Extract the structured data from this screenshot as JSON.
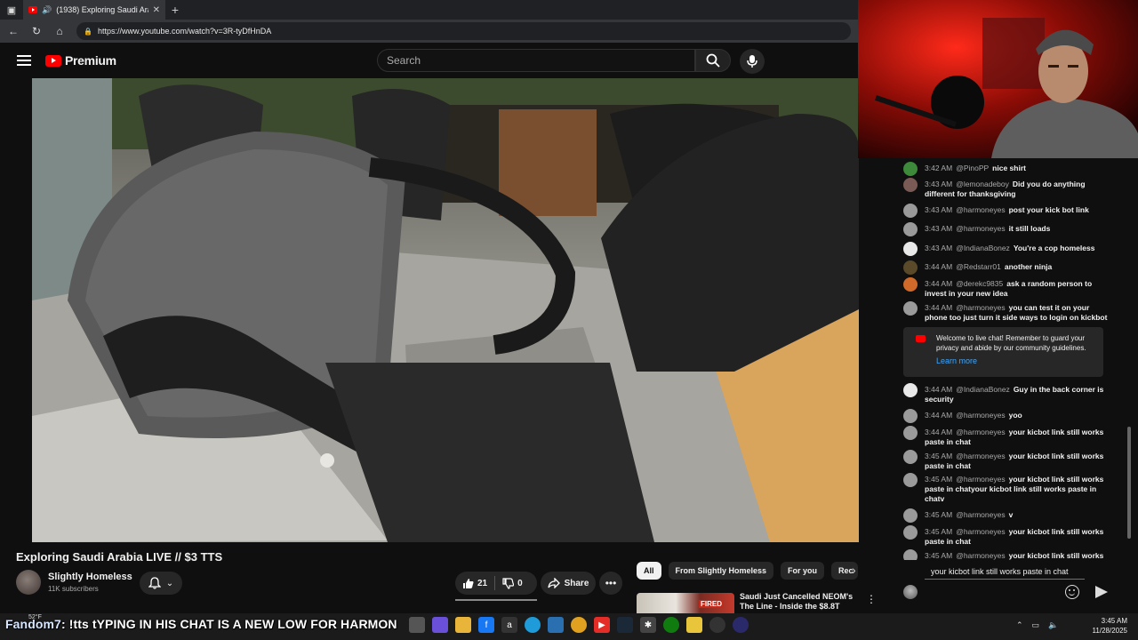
{
  "browser": {
    "tab_title": "(1938) Exploring Saudi Arabi",
    "url": "https://www.youtube.com/watch?v=3R-tyDfHnDA"
  },
  "masthead": {
    "logo_text": "Premium",
    "search_placeholder": "Search"
  },
  "video": {
    "title": "Exploring Saudi Arabia LIVE // $3 TTS",
    "channel_name": "Slightly Homeless",
    "subscribers": "11K subscribers",
    "likes": "21",
    "dislikes": "0",
    "share_label": "Share"
  },
  "chips": [
    "All",
    "From Slightly Homeless",
    "For you",
    "Rec"
  ],
  "recommended": {
    "title": "Saudi Just Cancelled NEOM's The Line - Inside the $8.8T",
    "thumb_badge": "FIRED"
  },
  "chat": {
    "messages": [
      {
        "time": "3:42 AM",
        "author": "@PinoPP",
        "text": "nice shirt",
        "avatar_color": "#3c8a3a"
      },
      {
        "time": "3:43 AM",
        "author": "@lemonadeboy",
        "text": "Did you do anything different for thanksgiving",
        "avatar_color": "#7a5a55"
      },
      {
        "time": "3:43 AM",
        "author": "@harmoneyes",
        "text": "post your kick bot link",
        "avatar_color": "#9a9a9a"
      },
      {
        "time": "3:43 AM",
        "author": "@harmoneyes",
        "text": "it still loads",
        "avatar_color": "#9a9a9a"
      },
      {
        "time": "3:43 AM",
        "author": "@IndianaBonez",
        "text": "You're a cop homeless",
        "avatar_color": "#e8e8e8"
      },
      {
        "time": "3:44 AM",
        "author": "@Redstarr01",
        "text": "another ninja",
        "avatar_color": "#5a4a2a"
      },
      {
        "time": "3:44 AM",
        "author": "@derekc9835",
        "text": "ask a random person to invest in your new idea",
        "avatar_color": "#d06a2a"
      },
      {
        "time": "3:44 AM",
        "author": "@harmoneyes",
        "text": "you can test it on your phone too just turn it side ways to login on kickbot",
        "avatar_color": "#9a9a9a"
      },
      {
        "time": "3:44 AM",
        "author": "@IndianaBonez",
        "text": "Guy in the back corner is security",
        "avatar_color": "#e8e8e8"
      },
      {
        "time": "3:44 AM",
        "author": "@harmoneyes",
        "text": "yoo",
        "avatar_color": "#9a9a9a"
      },
      {
        "time": "3:44 AM",
        "author": "@harmoneyes",
        "text": "your kicbot link still works paste in chat",
        "avatar_color": "#9a9a9a"
      },
      {
        "time": "3:45 AM",
        "author": "@harmoneyes",
        "text": "your kicbot link still works paste in chat",
        "avatar_color": "#9a9a9a"
      },
      {
        "time": "3:45 AM",
        "author": "@harmoneyes",
        "text": "your kicbot link still works paste in chatyour kicbot link still works paste in chatv",
        "avatar_color": "#9a9a9a"
      },
      {
        "time": "3:45 AM",
        "author": "@harmoneyes",
        "text": "v",
        "avatar_color": "#9a9a9a"
      },
      {
        "time": "3:45 AM",
        "author": "@harmoneyes",
        "text": "your kicbot link still works paste in chat",
        "avatar_color": "#9a9a9a"
      },
      {
        "time": "3:45 AM",
        "author": "@harmoneyes",
        "text": "your kicbot link still works",
        "avatar_color": "#9a9a9a"
      }
    ],
    "welcome_text": "Welcome to live chat! Remember to guard your privacy and abide by our community guidelines.",
    "learn_more": "Learn more",
    "input_value": "your kicbot link still works paste in chat"
  },
  "overlay": {
    "caption_name": "Fandom7",
    "caption_text": ": !tts tYPING IN HIS CHAT IS A NEW LOW FOR HARMON",
    "weather": "52°F"
  },
  "taskbar": {
    "time": "3:45 AM",
    "date": "11/28/2025"
  }
}
